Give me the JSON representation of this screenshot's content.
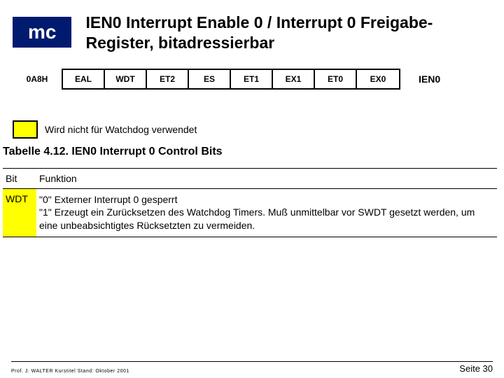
{
  "header": {
    "badge": "mc",
    "title": "IEN0 Interrupt Enable 0 / Interrupt 0 Freigabe-Register, bitadressierbar"
  },
  "register": {
    "address": "0A8H",
    "bits": [
      "EAL",
      "WDT",
      "ET2",
      "ES",
      "ET1",
      "EX1",
      "ET0",
      "EX0"
    ],
    "name": "IEN0"
  },
  "note": "Wird nicht für Watchdog verwendet",
  "table": {
    "caption": "Tabelle 4.12. IEN0 Interrupt 0 Control Bits",
    "head": {
      "bit": "Bit",
      "func": "Funktion"
    },
    "rows": [
      {
        "bit": "WDT",
        "func": "\"0\" Externer Interrupt 0 gesperrt\n\"1\" Erzeugt ein Zurücksetzen des Watchdog Timers. Muß unmittelbar vor SWDT gesetzt werden, um eine unbeabsichtigtes Rücksetzten zu vermeiden."
      }
    ]
  },
  "footer": {
    "left": "Prof. J. WALTER   Kurstitel  Stand: Oktober 2001",
    "right": "Seite 30"
  }
}
